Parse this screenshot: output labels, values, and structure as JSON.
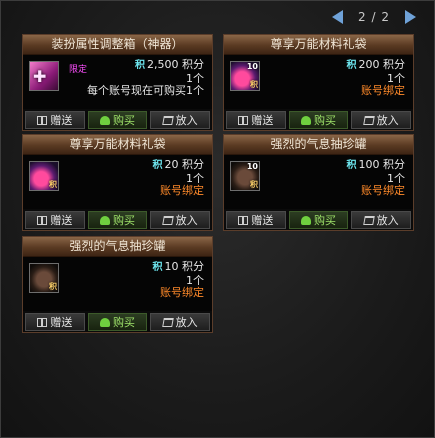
{
  "pager": {
    "text": "2 / 2"
  },
  "cards": [
    {
      "title": "装扮属性调整箱（神器）",
      "icon": "purple-box-icon",
      "limited_tag": "限定",
      "price_icon": "积",
      "price": "2,500 积分",
      "quantity": "1个",
      "note": "每个账号现在可购买1个",
      "actions": {
        "gift": "赠送",
        "buy": "购买",
        "cart": "放入"
      }
    },
    {
      "title": "尊享万能材料礼袋",
      "icon": "material-bag-icon",
      "icon_count": "10",
      "icon_tag": "积",
      "price_icon": "积",
      "price": "200 积分",
      "quantity": "1个",
      "note": "账号绑定",
      "actions": {
        "gift": "赠送",
        "buy": "购买",
        "cart": "放入"
      }
    },
    {
      "title": "尊享万能材料礼袋",
      "icon": "material-bag-icon",
      "icon_tag": "积",
      "price_icon": "积",
      "price": "20 积分",
      "quantity": "1个",
      "note": "账号绑定",
      "actions": {
        "gift": "赠送",
        "buy": "购买",
        "cart": "放入"
      }
    },
    {
      "title": "强烈的气息抽珍罐",
      "icon": "jar-icon",
      "icon_count": "10",
      "icon_tag": "积",
      "price_icon": "积",
      "price": "100 积分",
      "quantity": "1个",
      "note": "账号绑定",
      "actions": {
        "gift": "赠送",
        "buy": "购买",
        "cart": "放入"
      }
    },
    {
      "title": "强烈的气息抽珍罐",
      "icon": "jar-icon",
      "icon_tag": "积",
      "price_icon": "积",
      "price": "10 积分",
      "quantity": "1个",
      "note": "账号绑定",
      "actions": {
        "gift": "赠送",
        "buy": "购买",
        "cart": "放入"
      }
    }
  ]
}
